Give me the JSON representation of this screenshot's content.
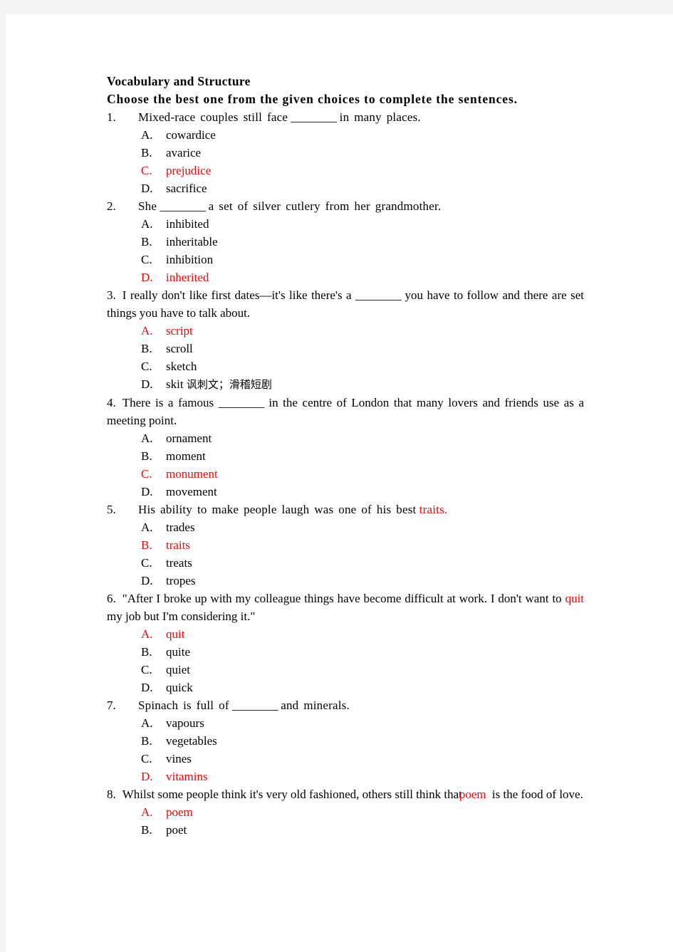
{
  "document": {
    "title": "Vocabulary and Structure",
    "instruction": "Choose the best one from the given choices to complete the sentences.",
    "accent_color": "#ff0000",
    "text_color": "#000000",
    "page_background": "#ffffff",
    "canvas_background": "#f4f4f4"
  },
  "questions": [
    {
      "number": "1.",
      "stem_before": "Mixed-race couples still face",
      "blank": "________",
      "stem_after": "in many places.",
      "options": [
        {
          "label": "A.",
          "text": "cowardice",
          "highlighted": false
        },
        {
          "label": "B.",
          "text": "avarice",
          "highlighted": false
        },
        {
          "label": "C.",
          "text": "prejudice",
          "highlighted": true
        },
        {
          "label": "D.",
          "text": "sacrifice",
          "highlighted": false
        }
      ]
    },
    {
      "number": "2.",
      "stem_before": "She",
      "blank": "________",
      "stem_after": "a set of silver cutlery from her grandmother.",
      "options": [
        {
          "label": "A.",
          "text": "inhibited",
          "highlighted": false
        },
        {
          "label": "B.",
          "text": "inheritable",
          "highlighted": false
        },
        {
          "label": "C.",
          "text": "inhibition",
          "highlighted": false
        },
        {
          "label": "D.",
          "text": "inherited",
          "highlighted": true
        }
      ]
    },
    {
      "number": "3.",
      "stem_before": "I really don't like first dates—it's like there's a",
      "blank": "________",
      "stem_after": "you have to follow and there are set things you have to talk about.",
      "options": [
        {
          "label": "A.",
          "text": "script",
          "highlighted": true
        },
        {
          "label": "B.",
          "text": "scroll",
          "highlighted": false
        },
        {
          "label": "C.",
          "text": "sketch",
          "highlighted": false
        },
        {
          "label": "D.",
          "text": "skit",
          "gloss": "讽刺文；滑稽短剧",
          "highlighted": false
        }
      ]
    },
    {
      "number": "4.",
      "stem_before": "There is a famous",
      "blank": "________",
      "stem_after": "in the centre of London that many lovers and friends use as a meeting point.",
      "options": [
        {
          "label": "A.",
          "text": "ornament",
          "highlighted": false
        },
        {
          "label": "B.",
          "text": "moment",
          "highlighted": false
        },
        {
          "label": "C.",
          "text": "monument",
          "highlighted": true
        },
        {
          "label": "D.",
          "text": "movement",
          "highlighted": false
        }
      ]
    },
    {
      "number": "5.",
      "stem_before": "His ability to make people laugh was one of his best",
      "inline_answer": "traits.",
      "stem_after": "",
      "options": [
        {
          "label": "A.",
          "text": "trades",
          "highlighted": false
        },
        {
          "label": "B.",
          "text": "traits",
          "highlighted": true
        },
        {
          "label": "C.",
          "text": "treats",
          "highlighted": false
        },
        {
          "label": "D.",
          "text": "tropes",
          "highlighted": false
        }
      ]
    },
    {
      "number": "6.",
      "stem_before": "\"After I broke up with my colleague things have become difficult at work. I don't want to",
      "inline_answer": "quit",
      "stem_after": "my job but I'm considering it.\"",
      "options": [
        {
          "label": "A.",
          "text": "quit",
          "highlighted": true
        },
        {
          "label": "B.",
          "text": "quite",
          "highlighted": false
        },
        {
          "label": "C.",
          "text": "quiet",
          "highlighted": false
        },
        {
          "label": "D.",
          "text": "quick",
          "highlighted": false
        }
      ]
    },
    {
      "number": "7.",
      "stem_before": "Spinach is full of",
      "blank": "________",
      "stem_after": "and minerals.",
      "options": [
        {
          "label": "A.",
          "text": "vapours",
          "highlighted": false
        },
        {
          "label": "B.",
          "text": "vegetables",
          "highlighted": false
        },
        {
          "label": "C.",
          "text": "vines",
          "highlighted": false
        },
        {
          "label": "D.",
          "text": "vitamins",
          "highlighted": true
        }
      ]
    },
    {
      "number": "8.",
      "stem_before": "Whilst some people think it's very old fashioned, others still think that",
      "inline_answer": "poem",
      "stem_after": "is the food of love.",
      "options": [
        {
          "label": "A.",
          "text": "poem",
          "highlighted": true
        },
        {
          "label": "B.",
          "text": "poet",
          "highlighted": false
        }
      ]
    }
  ]
}
